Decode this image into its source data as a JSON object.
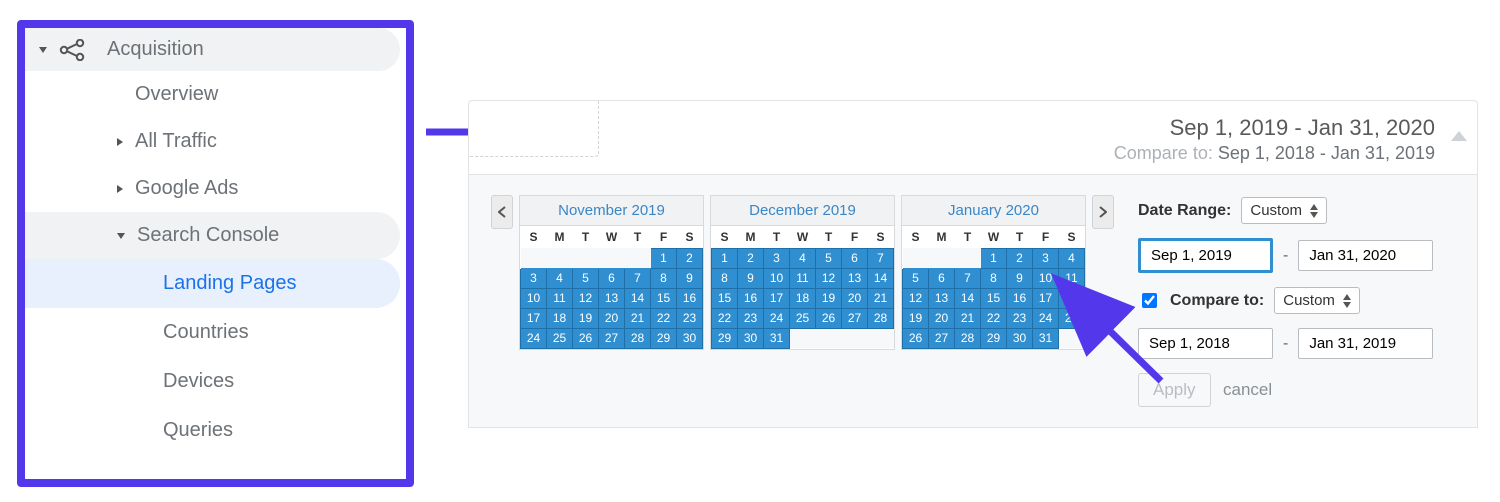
{
  "sidebar": {
    "section_label": "Acquisition",
    "items": [
      {
        "label": "Overview",
        "caret": false
      },
      {
        "label": "All Traffic",
        "caret": true
      },
      {
        "label": "Google Ads",
        "caret": true
      },
      {
        "label": "Search Console",
        "caret": true,
        "expanded": true,
        "children": [
          {
            "label": "Landing Pages",
            "active": true
          },
          {
            "label": "Countries"
          },
          {
            "label": "Devices"
          },
          {
            "label": "Queries"
          }
        ]
      }
    ]
  },
  "date_header": {
    "primary": "Sep 1, 2019 - Jan 31, 2020",
    "compare_prefix": "Compare to: ",
    "compare_range": "Sep 1, 2018 - Jan 31, 2019"
  },
  "controls": {
    "date_range_label": "Date Range:",
    "date_range_select": "Custom",
    "start1": "Sep 1, 2019",
    "end1": "Jan 31, 2020",
    "compare_label": "Compare to:",
    "compare_checked": true,
    "compare_select": "Custom",
    "start2": "Sep 1, 2018",
    "end2": "Jan 31, 2019",
    "apply": "Apply",
    "cancel": "cancel"
  },
  "calendars": {
    "dow": [
      "S",
      "M",
      "T",
      "W",
      "T",
      "F",
      "S"
    ],
    "months": [
      {
        "title": "November 2019",
        "lead": 5,
        "days": 30,
        "sel_all": true,
        "sel_from": 1
      },
      {
        "title": "December 2019",
        "lead": 0,
        "days": 31,
        "sel_all": true,
        "sel_from": 1
      },
      {
        "title": "January 2020",
        "lead": 3,
        "days": 31,
        "sel_all": true,
        "sel_from": 1
      }
    ]
  },
  "colors": {
    "accent": "#5238ea",
    "sel": "#2f8fd1",
    "link": "#1a73e8"
  }
}
